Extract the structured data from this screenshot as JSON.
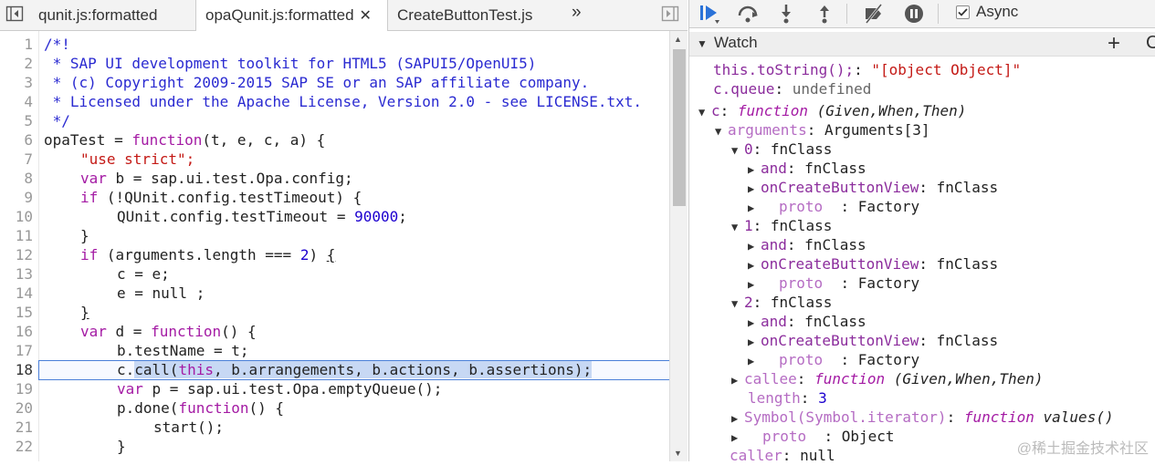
{
  "editor": {
    "tabs": [
      {
        "label": "qunit.js:formatted",
        "active": false,
        "closable": false
      },
      {
        "label": "opaQunit.js:formatted",
        "active": true,
        "closable": true
      },
      {
        "label": "CreateButtonTest.js",
        "active": false,
        "closable": false
      }
    ],
    "tab_overflow": "»",
    "lines": [
      {
        "n": "1"
      },
      {
        "n": "2"
      },
      {
        "n": "3"
      },
      {
        "n": "4"
      },
      {
        "n": "5"
      },
      {
        "n": "6"
      },
      {
        "n": "7"
      },
      {
        "n": "8"
      },
      {
        "n": "9"
      },
      {
        "n": "10"
      },
      {
        "n": "11"
      },
      {
        "n": "12"
      },
      {
        "n": "13"
      },
      {
        "n": "14"
      },
      {
        "n": "15"
      },
      {
        "n": "16"
      },
      {
        "n": "17"
      },
      {
        "n": "18"
      },
      {
        "n": "19"
      },
      {
        "n": "20"
      },
      {
        "n": "21"
      },
      {
        "n": "22"
      }
    ],
    "code": {
      "l1": "/*!",
      "l2": " * SAP UI development toolkit for HTML5 (SAPUI5/OpenUI5)",
      "l3": " * (c) Copyright 2009-2015 SAP SE or an SAP affiliate company.",
      "l4": " * Licensed under the Apache License, Version 2.0 - see LICENSE.txt.",
      "l5": " */",
      "l6a": "opaTest = ",
      "l6b": "function",
      "l6c": "(t, e, c, a) {",
      "l7": "\"use strict\";",
      "l8a": "var",
      "l8b": " b = sap.ui.test.Opa.config;",
      "l9a": "if",
      "l9b": " (!QUnit.config.testTimeout) {",
      "l10a": "QUnit.config.testTimeout = ",
      "l10b": "90000",
      "l10c": ";",
      "l11": "}",
      "l12a": "if",
      "l12b": " (arguments.length === ",
      "l12c": "2",
      "l12d": ") ",
      "l12e": "{",
      "l13": "c = e;",
      "l14": "e = null ;",
      "l15": "}",
      "l16a": "var",
      "l16b": " d = ",
      "l16c": "function",
      "l16d": "() {",
      "l17": "b.testName = t;",
      "l18a": "c.",
      "l18b": "call(",
      "l18c": "this",
      "l18d": ", b.arrangements, b.actions, b.assertions);",
      "l19a": "var",
      "l19b": " p = sap.ui.test.Opa.emptyQueue();",
      "l20a": "p.done(",
      "l20b": "function",
      "l20c": "() {",
      "l21": "start();",
      "l22": "}"
    }
  },
  "debugger": {
    "toolbar": {
      "async_label": "Async",
      "async_checked": true
    },
    "watch": {
      "title": "Watch",
      "add_label": "+",
      "refresh_label": "C",
      "rows": {
        "r1k": "this.toString();",
        "r1s": ": ",
        "r1v": "\"[object Object]\"",
        "r2k": "c.queue",
        "r2s": ": ",
        "r2v": "undefined",
        "r3k": "c",
        "r3s": ": ",
        "r3f": "function",
        "r3v": " (Given,When,Then)",
        "r4k": "arguments",
        "r4v": ": Arguments[3]",
        "r5k": "0",
        "r5v": ": fnClass",
        "r6k": "and",
        "r6v": ": fnClass",
        "r7k": "onCreateButtonView",
        "r7v": ": fnClass",
        "r8k": "proto",
        "r8v": "  : Factory",
        "r9k": "1",
        "r9v": ": fnClass",
        "r10k": "and",
        "r10v": ": fnClass",
        "r11k": "onCreateButtonView",
        "r11v": ": fnClass",
        "r12k": "proto",
        "r12v": "  : Factory",
        "r13k": "2",
        "r13v": ": fnClass",
        "r14k": "and",
        "r14v": ": fnClass",
        "r15k": "onCreateButtonView",
        "r15v": ": fnClass",
        "r16k": "proto",
        "r16v": "  : Factory",
        "r17k": "callee",
        "r17s": ": ",
        "r17f": "function",
        "r17v": " (Given,When,Then)",
        "r18k": "length",
        "r18s": ": ",
        "r18v": "3",
        "r19k": "Symbol(Symbol.iterator)",
        "r19s": ": ",
        "r19f": "function",
        "r19v": " values()",
        "r20k": "proto",
        "r20v": "  : Object",
        "r21k": "caller",
        "r21v": ": null"
      }
    }
  },
  "watermark": "@稀土掘金技术社区",
  "colors": {
    "accent": "#4a7fd8",
    "keyword": "#a41ba4",
    "string": "#c41a16",
    "number": "#1c00cf"
  }
}
